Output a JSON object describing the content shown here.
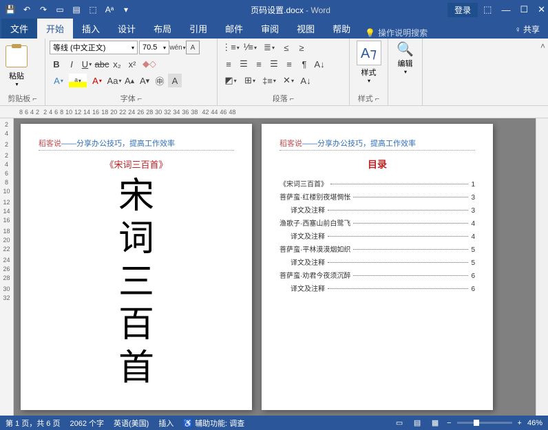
{
  "titlebar": {
    "doc_name": "页码设置.docx",
    "app": "Word",
    "login": "登录"
  },
  "tabs": {
    "file": "文件",
    "home": "开始",
    "insert": "插入",
    "design": "设计",
    "layout": "布局",
    "ref": "引用",
    "mail": "邮件",
    "review": "审阅",
    "view": "视图",
    "help": "帮助",
    "tell": "操作说明搜索",
    "share": "共享"
  },
  "ribbon": {
    "clipboard": {
      "paste": "粘贴",
      "label": "剪贴板"
    },
    "font": {
      "name": "等线 (中文正文)",
      "size": "70.5",
      "label": "字体"
    },
    "para": {
      "label": "段落"
    },
    "styles": {
      "btn": "样式",
      "label": "样式"
    },
    "edit": {
      "btn": "编辑"
    }
  },
  "ruler_h": [
    "8",
    "6",
    "4",
    "2",
    "",
    "2",
    "4",
    "6",
    "8",
    "10",
    "12",
    "14",
    "16",
    "18",
    "20",
    "22",
    "24",
    "26",
    "28",
    "30",
    "32",
    "34",
    "36",
    "38",
    "",
    "42",
    "44",
    "46",
    "48"
  ],
  "ruler_v": [
    "2",
    "4",
    "",
    "2",
    "",
    "2",
    "4",
    "6",
    "8",
    "10",
    "",
    "12",
    "14",
    "16",
    "",
    "18",
    "20",
    "22",
    "",
    "24",
    "26",
    "28",
    "",
    "30",
    "32"
  ],
  "page1": {
    "header": {
      "red": "稻客说",
      "blue": "——分享办公技巧，提高工作效率"
    },
    "book_title": "《宋词三百首》",
    "chars": [
      "宋",
      "词",
      "三",
      "百",
      "首"
    ]
  },
  "page2": {
    "header": {
      "red": "稻客说",
      "blue": "——分享办公技巧，提高工作效率"
    },
    "toc_title": "目录",
    "toc": [
      {
        "text": "《宋词三百首》",
        "page": "1",
        "indent": false
      },
      {
        "text": "菩萨蛮·红楼别夜堪惆怅",
        "page": "3",
        "indent": false
      },
      {
        "text": "译文及注释",
        "page": "3",
        "indent": true
      },
      {
        "text": "渔歌子·西塞山前白鹭飞",
        "page": "4",
        "indent": false
      },
      {
        "text": "译文及注释",
        "page": "4",
        "indent": true
      },
      {
        "text": "菩萨蛮·平林漠漠烟如织",
        "page": "5",
        "indent": false
      },
      {
        "text": "译文及注释",
        "page": "5",
        "indent": true
      },
      {
        "text": "菩萨蛮·劝君今夜须沉醉",
        "page": "6",
        "indent": false
      },
      {
        "text": "译文及注释",
        "page": "6",
        "indent": true
      }
    ]
  },
  "status": {
    "page": "第 1 页，共 6 页",
    "words": "2062 个字",
    "lang": "英语(美国)",
    "insert": "插入",
    "acc": "辅助功能: 调查",
    "zoom": "46%"
  }
}
